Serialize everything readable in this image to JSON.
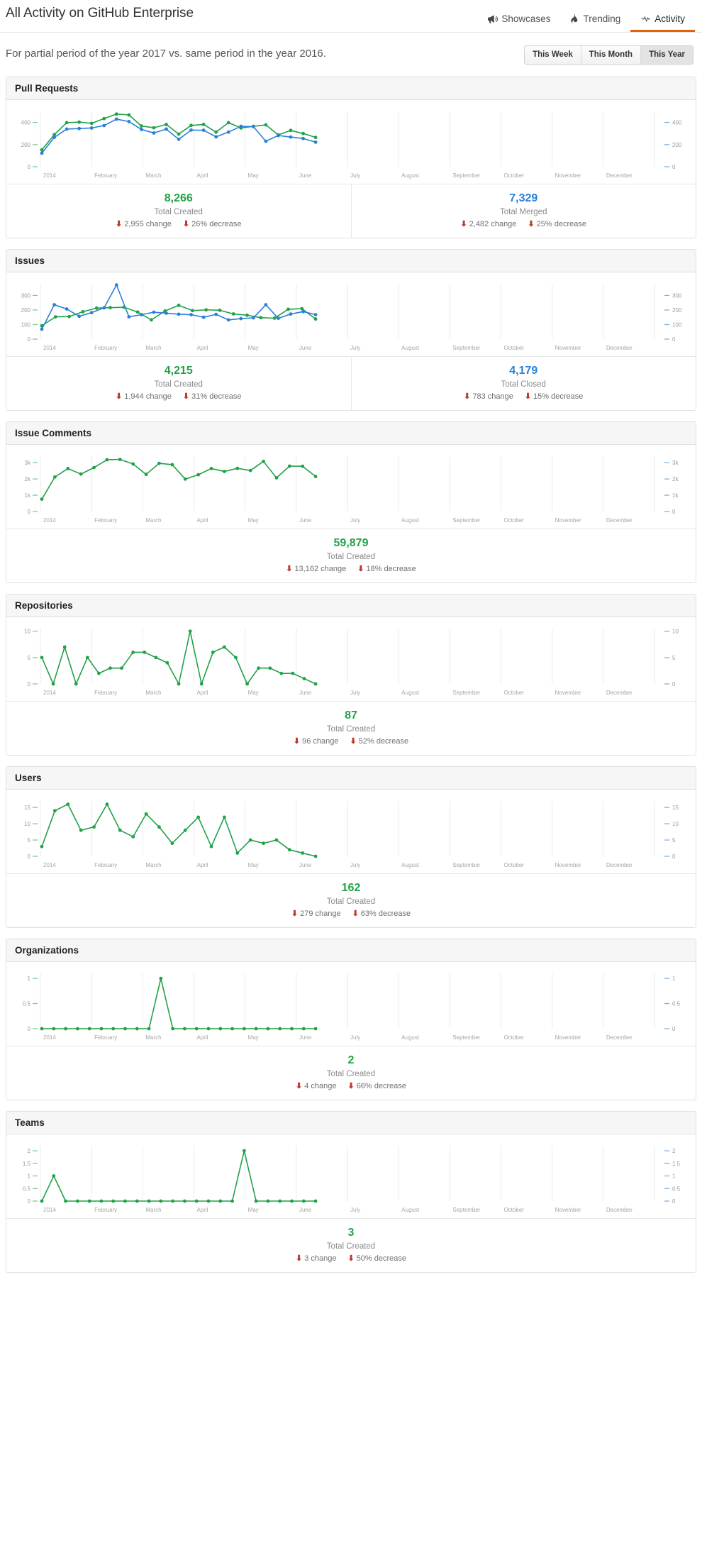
{
  "header": {
    "title": "All Activity on GitHub Enterprise",
    "nav": [
      {
        "label": "Showcases",
        "icon": "megaphone-icon",
        "active": false
      },
      {
        "label": "Trending",
        "icon": "flame-icon",
        "active": false
      },
      {
        "label": "Activity",
        "icon": "pulse-icon",
        "active": true
      }
    ]
  },
  "subtitle": "For partial period of the year 2017 vs. same period in the year 2016.",
  "range_buttons": [
    {
      "label": "This Week",
      "active": false
    },
    {
      "label": "This Month",
      "active": false
    },
    {
      "label": "This Year",
      "active": true
    }
  ],
  "colors": {
    "green": "#21a148",
    "blue": "#2980d9",
    "red": "#c0392b",
    "accent": "#e36209",
    "grid": "#eaeaea"
  },
  "months": [
    "2014",
    "February",
    "March",
    "April",
    "May",
    "June",
    "July",
    "August",
    "September",
    "October",
    "November",
    "December"
  ],
  "panels": [
    {
      "title": "Pull Requests",
      "chart_data": {
        "type": "line",
        "title": "Pull Requests",
        "xlabel": "",
        "ylabel": "",
        "ylim": [
          0,
          500
        ],
        "yticks": [
          0,
          200,
          400
        ],
        "ytick_labels": [
          "0",
          "200",
          "400"
        ],
        "grid": true,
        "legend": "none",
        "categories": [
          "2014",
          "February",
          "March",
          "April",
          "May",
          "June",
          "July",
          "August",
          "September",
          "October",
          "November",
          "December"
        ],
        "series": [
          {
            "name": "Created",
            "color": "#21a148",
            "values": [
              152,
              290,
              398,
              403,
              392,
              435,
              476,
              468,
              368,
              352,
              382,
              295,
              373,
              382,
              313,
              398,
              350,
              365,
              378,
              288,
              328,
              300,
              265
            ]
          },
          {
            "name": "Merged",
            "color": "#2980d9",
            "values": [
              122,
              265,
              340,
              345,
              350,
              372,
              430,
              408,
              337,
              305,
              340,
              248,
              331,
              330,
              270,
              313,
              365,
              362,
              230,
              282,
              268,
              255,
              222
            ]
          }
        ]
      },
      "stats": [
        {
          "total": "8,266",
          "color": "green",
          "label": "Total Created",
          "change": "2,955 change",
          "percent": "26% decrease"
        },
        {
          "total": "7,329",
          "color": "blue",
          "label": "Total Merged",
          "change": "2,482 change",
          "percent": "25% decrease"
        }
      ]
    },
    {
      "title": "Issues",
      "chart_data": {
        "type": "line",
        "title": "Issues",
        "xlabel": "",
        "ylabel": "",
        "ylim": [
          0,
          380
        ],
        "yticks": [
          0,
          100,
          200,
          300
        ],
        "ytick_labels": [
          "0",
          "100",
          "200",
          "300"
        ],
        "grid": true,
        "legend": "none",
        "categories": [
          "2014",
          "February",
          "March",
          "April",
          "May",
          "June",
          "July",
          "August",
          "September",
          "October",
          "November",
          "December"
        ],
        "series": [
          {
            "name": "Created",
            "color": "#21a148",
            "values": [
              92,
              153,
              155,
              188,
              213,
              216,
              219,
              186,
              132,
              193,
              232,
              196,
              201,
              198,
              173,
              164,
              147,
              144,
              205,
              209,
              138
            ]
          },
          {
            "name": "Closed",
            "color": "#2980d9",
            "values": [
              68,
              236,
              207,
              157,
              182,
              215,
              372,
              153,
              168,
              185,
              178,
              171,
              168,
              150,
              170,
              132,
              141,
              146,
              236,
              143,
              172,
              189,
              168
            ]
          }
        ]
      },
      "stats": [
        {
          "total": "4,215",
          "color": "green",
          "label": "Total Created",
          "change": "1,944 change",
          "percent": "31% decrease"
        },
        {
          "total": "4,179",
          "color": "blue",
          "label": "Total Closed",
          "change": "783 change",
          "percent": "15% decrease"
        }
      ]
    },
    {
      "title": "Issue Comments",
      "chart_data": {
        "type": "line",
        "title": "Issue Comments",
        "xlabel": "",
        "ylabel": "",
        "ylim": [
          0,
          3400
        ],
        "yticks": [
          0,
          1000,
          2000,
          3000
        ],
        "ytick_labels": [
          "0",
          "1k",
          "2k",
          "3k"
        ],
        "grid": true,
        "legend": "none",
        "categories": [
          "2014",
          "February",
          "March",
          "April",
          "May",
          "June",
          "July",
          "August",
          "September",
          "October",
          "November",
          "December"
        ],
        "series": [
          {
            "name": "Created",
            "color": "#21a148",
            "values": [
              760,
              2120,
              2640,
              2300,
              2700,
              3180,
              3200,
              2920,
              2280,
              2960,
              2880,
              1990,
              2260,
              2640,
              2460,
              2650,
              2520,
              3080,
              2070,
              2790,
              2780,
              2150
            ]
          }
        ]
      },
      "stats": [
        {
          "total": "59,879",
          "color": "green",
          "label": "Total Created",
          "change": "13,162 change",
          "percent": "18% decrease"
        }
      ]
    },
    {
      "title": "Repositories",
      "chart_data": {
        "type": "line",
        "title": "Repositories",
        "xlabel": "",
        "ylabel": "",
        "ylim": [
          0,
          10.5
        ],
        "yticks": [
          0,
          5,
          10
        ],
        "ytick_labels": [
          "0",
          "5",
          "10"
        ],
        "grid": true,
        "legend": "none",
        "categories": [
          "2014",
          "February",
          "March",
          "April",
          "May",
          "June",
          "July",
          "August",
          "September",
          "October",
          "November",
          "December"
        ],
        "series": [
          {
            "name": "Created",
            "color": "#21a148",
            "values": [
              5,
              0,
              7,
              0,
              5,
              2,
              3,
              3,
              6,
              6,
              5,
              4,
              0,
              10,
              0,
              6,
              7,
              5,
              0,
              3,
              3,
              2,
              2,
              1,
              0
            ]
          }
        ]
      },
      "stats": [
        {
          "total": "87",
          "color": "green",
          "label": "Total Created",
          "change": "96 change",
          "percent": "52% decrease"
        }
      ]
    },
    {
      "title": "Users",
      "chart_data": {
        "type": "line",
        "title": "Users",
        "xlabel": "",
        "ylabel": "",
        "ylim": [
          0,
          17
        ],
        "yticks": [
          0,
          5,
          10,
          15
        ],
        "ytick_labels": [
          "0",
          "5",
          "10",
          "15"
        ],
        "grid": true,
        "legend": "none",
        "categories": [
          "2014",
          "February",
          "March",
          "April",
          "May",
          "June",
          "July",
          "August",
          "September",
          "October",
          "November",
          "December"
        ],
        "series": [
          {
            "name": "Created",
            "color": "#21a148",
            "values": [
              3,
              14,
              16,
              8,
              9,
              16,
              8,
              6,
              13,
              9,
              4,
              8,
              12,
              3,
              12,
              1,
              5,
              4,
              5,
              2,
              1,
              0
            ]
          }
        ]
      },
      "stats": [
        {
          "total": "162",
          "color": "green",
          "label": "Total Created",
          "change": "279 change",
          "percent": "63% decrease"
        }
      ]
    },
    {
      "title": "Organizations",
      "chart_data": {
        "type": "line",
        "title": "Organizations",
        "xlabel": "",
        "ylabel": "",
        "ylim": [
          0,
          1.1
        ],
        "yticks": [
          0,
          0.5,
          1
        ],
        "ytick_labels": [
          "0",
          "0.5",
          "1"
        ],
        "grid": true,
        "legend": "none",
        "categories": [
          "2014",
          "February",
          "March",
          "April",
          "May",
          "June",
          "July",
          "August",
          "September",
          "October",
          "November",
          "December"
        ],
        "series": [
          {
            "name": "Created",
            "color": "#21a148",
            "values": [
              0,
              0,
              0,
              0,
              0,
              0,
              0,
              0,
              0,
              0,
              1,
              0,
              0,
              0,
              0,
              0,
              0,
              0,
              0,
              0,
              0,
              0,
              0,
              0
            ]
          }
        ]
      },
      "stats": [
        {
          "total": "2",
          "color": "green",
          "label": "Total Created",
          "change": "4 change",
          "percent": "66% decrease"
        }
      ]
    },
    {
      "title": "Teams",
      "chart_data": {
        "type": "line",
        "title": "Teams",
        "xlabel": "",
        "ylabel": "",
        "ylim": [
          0,
          2.2
        ],
        "yticks": [
          0,
          0.5,
          1,
          1.5,
          2
        ],
        "ytick_labels": [
          "0",
          "0.5",
          "1",
          "1.5",
          "2"
        ],
        "grid": true,
        "legend": "none",
        "categories": [
          "2014",
          "February",
          "March",
          "April",
          "May",
          "June",
          "July",
          "August",
          "September",
          "October",
          "November",
          "December"
        ],
        "series": [
          {
            "name": "Created",
            "color": "#21a148",
            "values": [
              0,
              1,
              0,
              0,
              0,
              0,
              0,
              0,
              0,
              0,
              0,
              0,
              0,
              0,
              0,
              0,
              0,
              2,
              0,
              0,
              0,
              0,
              0,
              0
            ]
          }
        ]
      },
      "stats": [
        {
          "total": "3",
          "color": "green",
          "label": "Total Created",
          "change": "3 change",
          "percent": "50% decrease"
        }
      ]
    }
  ]
}
